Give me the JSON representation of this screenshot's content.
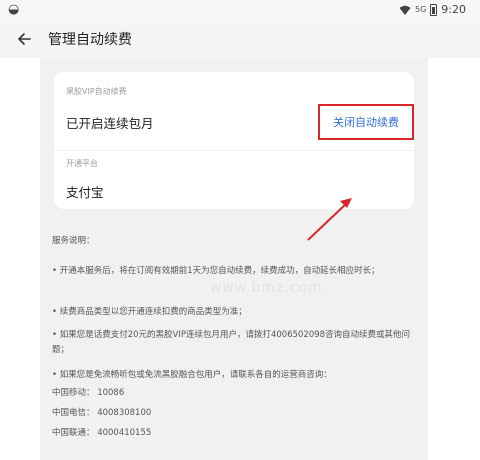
{
  "status_bar": {
    "time": "9:20",
    "network": "5G"
  },
  "app_bar": {
    "title": "管理自动续费"
  },
  "card": {
    "vip_label": "黑胶VIP自动续费",
    "vip_status": "已开启连续包月",
    "close_button": "关闭自动续费",
    "platform_label": "开通平台",
    "platform_value": "支付宝"
  },
  "description": {
    "heading": "服务说明：",
    "items": [
      "• 开通本服务后，将在订阅有效期前1天为您自动续费，续费成功，自动延长相应时长；",
      "• 续费商品类型以您开通连续扣费的商品类型为准；",
      "• 如果您是话费支付20元的黑胶VIP连续包月用户，请拨打4006502098咨询自动续费或其他问题；",
      "• 如果您是免流畅听包或免流黑胶融合包用户，请联系各自的运营商咨询："
    ],
    "carriers": [
      "中国移动：  10086",
      "中国电信：  4008308100",
      "中国联通：  4000410155"
    ]
  },
  "watermark": "www.bmz.com",
  "colors": {
    "accent_link": "#2f6fd8",
    "highlight_border": "#d9262b"
  }
}
